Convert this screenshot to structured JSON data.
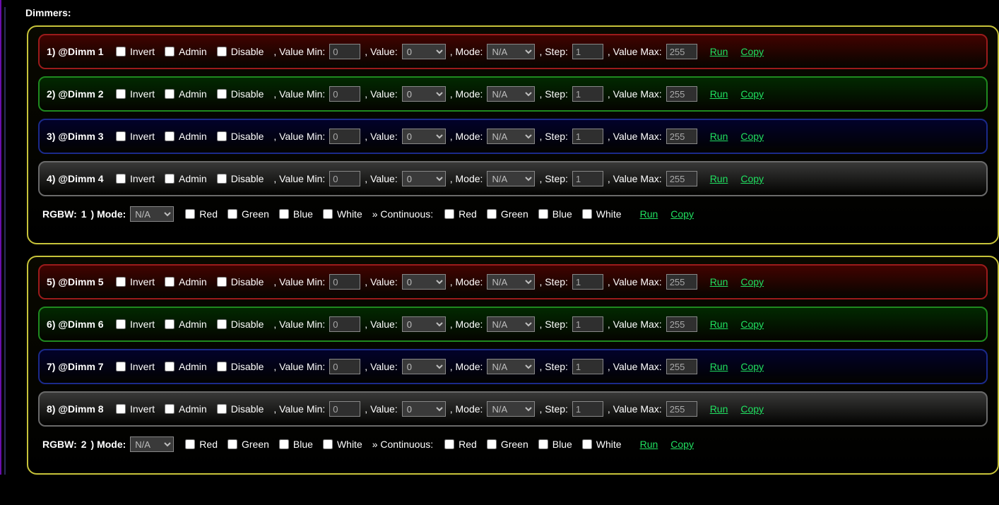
{
  "section_title": "Dimmers:",
  "labels": {
    "invert": "Invert",
    "admin": "Admin",
    "disable": "Disable",
    "value_min": ", Value Min:",
    "value": ", Value:",
    "mode": ", Mode:",
    "step": ", Step:",
    "value_max": ", Value Max:",
    "run": "Run",
    "copy": "Copy",
    "rgbw_prefix": "RGBW:",
    "rgbw_suffix": ") Mode:",
    "red": "Red",
    "green": "Green",
    "blue": "Blue",
    "white": "White",
    "continuous_sep": "» Continuous:"
  },
  "mode_option": "N/A",
  "value_option": "0",
  "groups": [
    {
      "rgbw_index": "1",
      "dimmers": [
        {
          "idx": "1)",
          "name": "@Dimm 1",
          "color": "red",
          "vmin": "0",
          "value": "0",
          "mode": "N/A",
          "step": "1",
          "vmax": "255"
        },
        {
          "idx": "2)",
          "name": "@Dimm 2",
          "color": "green",
          "vmin": "0",
          "value": "0",
          "mode": "N/A",
          "step": "1",
          "vmax": "255"
        },
        {
          "idx": "3)",
          "name": "@Dimm 3",
          "color": "blue",
          "vmin": "0",
          "value": "0",
          "mode": "N/A",
          "step": "1",
          "vmax": "255"
        },
        {
          "idx": "4)",
          "name": "@Dimm 4",
          "color": "gray",
          "vmin": "0",
          "value": "0",
          "mode": "N/A",
          "step": "1",
          "vmax": "255"
        }
      ]
    },
    {
      "rgbw_index": "2",
      "dimmers": [
        {
          "idx": "5)",
          "name": "@Dimm 5",
          "color": "red",
          "vmin": "0",
          "value": "0",
          "mode": "N/A",
          "step": "1",
          "vmax": "255"
        },
        {
          "idx": "6)",
          "name": "@Dimm 6",
          "color": "green",
          "vmin": "0",
          "value": "0",
          "mode": "N/A",
          "step": "1",
          "vmax": "255"
        },
        {
          "idx": "7)",
          "name": "@Dimm 7",
          "color": "blue",
          "vmin": "0",
          "value": "0",
          "mode": "N/A",
          "step": "1",
          "vmax": "255"
        },
        {
          "idx": "8)",
          "name": "@Dimm 8",
          "color": "gray",
          "vmin": "0",
          "value": "0",
          "mode": "N/A",
          "step": "1",
          "vmax": "255"
        }
      ]
    }
  ]
}
